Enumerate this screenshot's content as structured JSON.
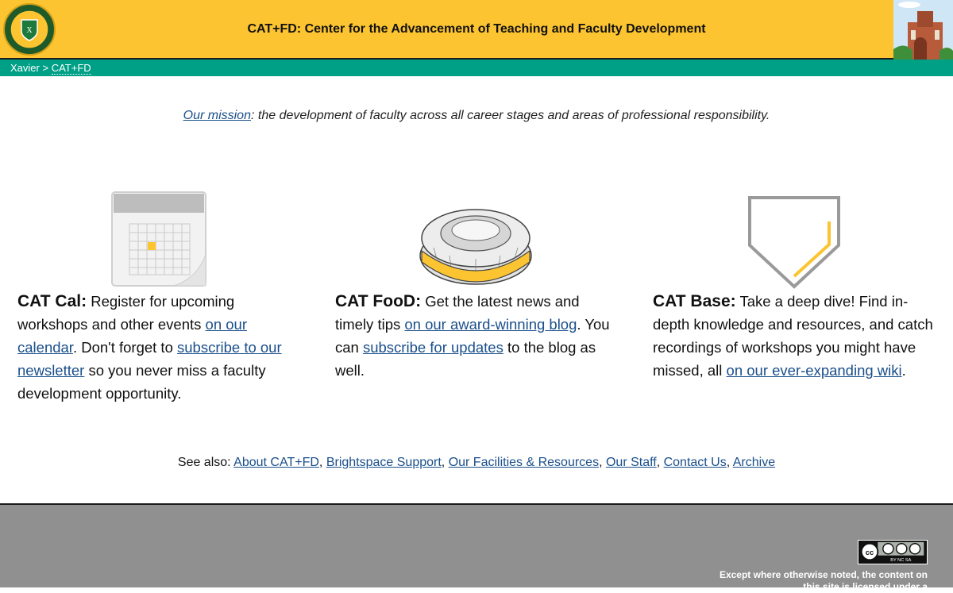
{
  "header": {
    "title": "CAT+FD: Center for the Advancement of Teaching and Faculty Development",
    "seal_text": "XAVIER UNIVERSITY OF LOUISIANA",
    "colors": {
      "header_bg": "#fcc431",
      "nav_bg": "#00a087",
      "footer_bg": "#909090",
      "link": "#1a4f8b",
      "accent": "#fcc431"
    }
  },
  "breadcrumb": {
    "root": "Xavier",
    "separator": ">",
    "current": "CAT+FD"
  },
  "mission": {
    "link_label": "Our mission",
    "text": ": the development of faculty across all career stages and areas of professional responsibility."
  },
  "columns": [
    {
      "icon": "calendar-icon",
      "lead": "CAT Cal:",
      "t1": " Register for upcoming workshops and other events ",
      "link1": "on our calendar",
      "t2": ". Don't forget to ",
      "link2": "subscribe to our newsletter",
      "t3": " so you never miss a faculty development opportunity."
    },
    {
      "icon": "bowl-icon",
      "lead": "CAT FooD:",
      "t1": " Get the latest news and timely tips ",
      "link1": "on our award-winning blog",
      "t2": ". You can ",
      "link2": "subscribe for updates",
      "t3": " to the blog as well."
    },
    {
      "icon": "home-plate-icon",
      "lead": "CAT Base:",
      "t1": " Take a deep dive! Find in-depth knowledge and resources, and catch recordings of workshops you might have missed, all ",
      "link1": "on our ever-expanding wiki",
      "t2": "."
    }
  ],
  "see_also": {
    "label": "See also:",
    "links": [
      "About CAT+FD",
      "Brightspace Support",
      "Our Facilities & Resources",
      "Our Staff",
      "Contact Us",
      "Archive"
    ]
  },
  "footer": {
    "badge_text": "BY NC SA",
    "license_text": "Except where otherwise noted, the content on this site is licensed under a"
  }
}
